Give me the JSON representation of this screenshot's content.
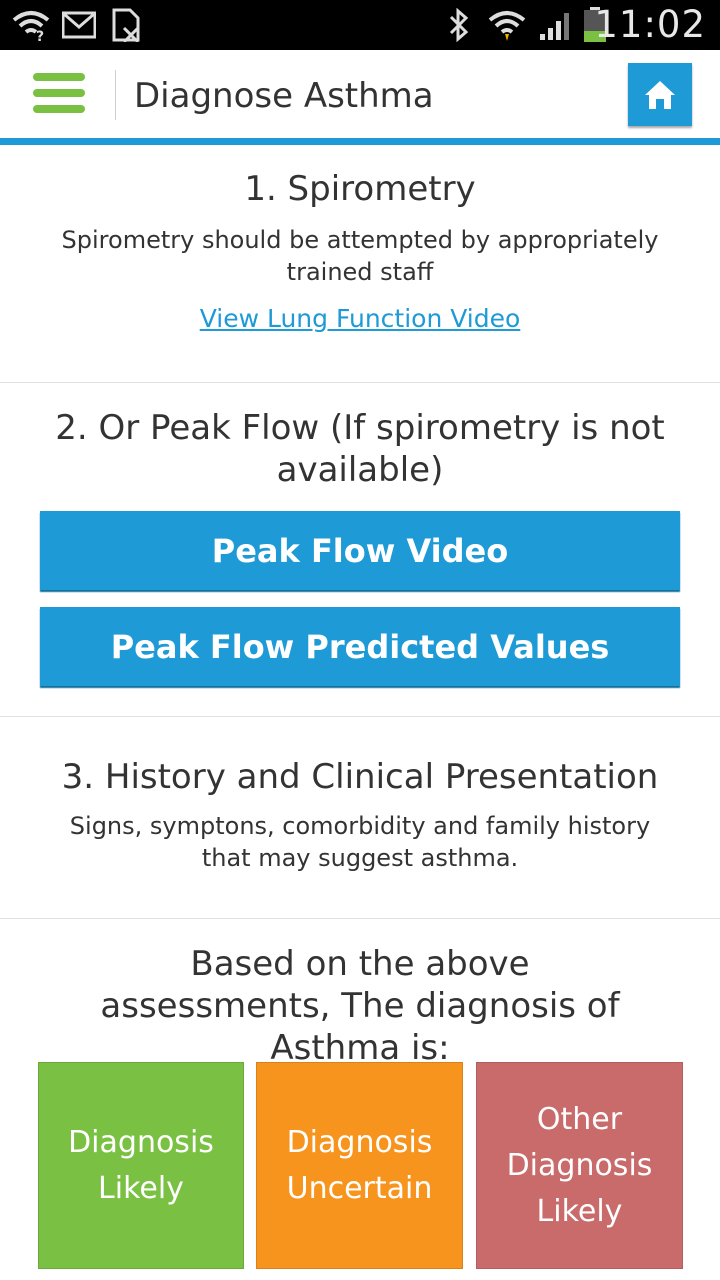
{
  "status_bar": {
    "time": "11:02",
    "icons": [
      "wifi-alert-icon",
      "gmail-icon",
      "no-sim-icon",
      "bluetooth-icon",
      "wifi-icon",
      "signal-icon",
      "battery-icon"
    ]
  },
  "header": {
    "title": "Diagnose Asthma",
    "menu_icon": "hamburger-menu-icon",
    "home_icon": "home-icon"
  },
  "sections": {
    "spirometry": {
      "title": "1. Spirometry",
      "text": "Spirometry should be attempted by appropriately trained staff",
      "link": "View Lung Function Video"
    },
    "peak_flow": {
      "title": "2. Or Peak Flow (If spirometry is not available)",
      "button_video": "Peak Flow Video",
      "button_values": "Peak Flow Predicted Values"
    },
    "history": {
      "title": "3. History and Clinical Presentation",
      "text": "Signs, symptons, comorbidity and family history that may suggest asthma."
    },
    "diagnosis": {
      "title": "Based on the above assessments, The diagnosis of Asthma is:",
      "tiles": [
        {
          "label": "Diagnosis\nLikely",
          "color": "#7ac143"
        },
        {
          "label": "Diagnosis\nUncertain",
          "color": "#f7941e"
        },
        {
          "label": "Other\nDiagnosis\nLikely",
          "color": "#c96b6b"
        }
      ]
    }
  },
  "colors": {
    "accent": "#1e9ad6",
    "menu": "#7ac143"
  }
}
